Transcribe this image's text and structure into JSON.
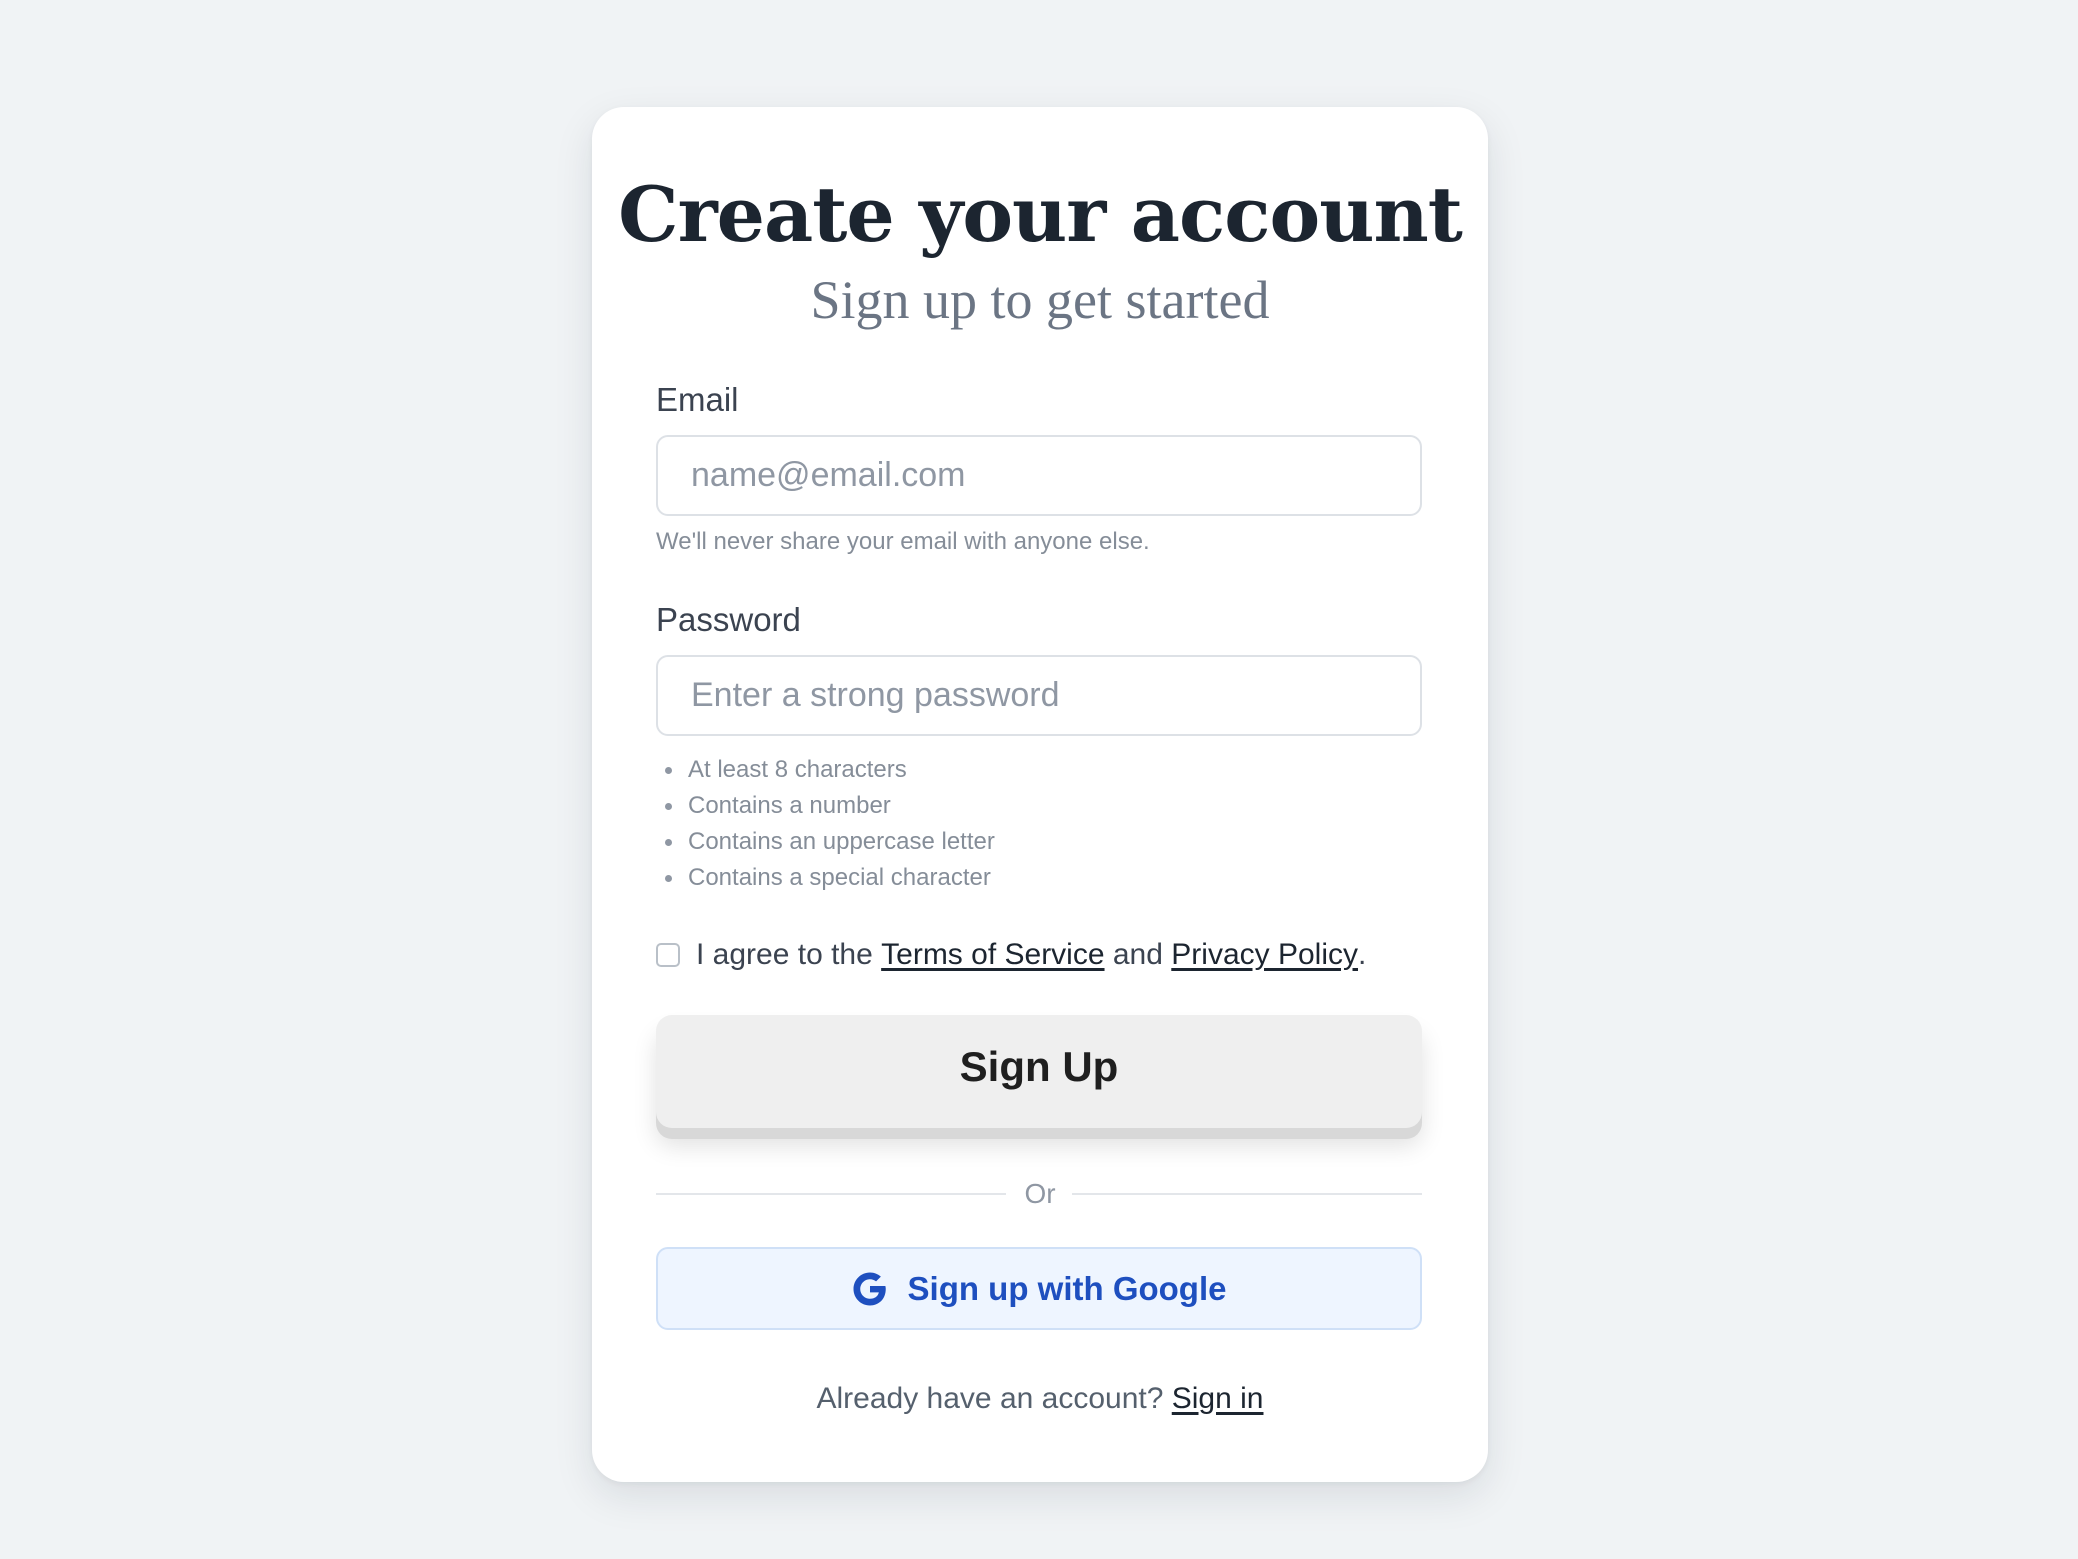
{
  "header": {
    "title": "Create your account",
    "subtitle": "Sign up to get started"
  },
  "email": {
    "label": "Email",
    "placeholder": "name@email.com",
    "value": "",
    "hint": "We'll never share your email with anyone else."
  },
  "password": {
    "label": "Password",
    "placeholder": "Enter a strong password",
    "value": "",
    "requirements": [
      "At least 8 characters",
      "Contains a number",
      "Contains an uppercase letter",
      "Contains a special character"
    ]
  },
  "agreement": {
    "checked": false,
    "prefix": "I agree to the",
    "terms_link": "Terms of Service",
    "conjunction": "and",
    "privacy_link": "Privacy Policy",
    "suffix": "."
  },
  "signup_button": {
    "label": "Sign Up"
  },
  "divider": {
    "label": "Or"
  },
  "google_button": {
    "label": "Sign up with Google",
    "icon": "google-g-icon"
  },
  "footer": {
    "prompt": "Already have an account?",
    "link": "Sign in"
  },
  "colors": {
    "page_background": "#f0f3f5",
    "card_background": "#ffffff",
    "title": "#1c2530",
    "subtitle": "#6b7584",
    "google_accent": "#1e4fbf",
    "google_background": "#eef5ff"
  }
}
